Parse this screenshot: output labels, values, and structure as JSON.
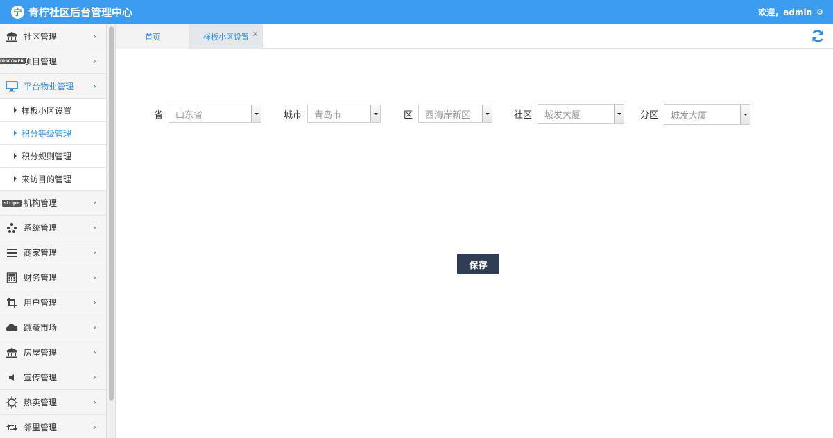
{
  "header": {
    "title": "青柠社区后台管理中心",
    "logo_char": "宁",
    "welcome": "欢迎，admin",
    "settings_icon": "gear-icon"
  },
  "sidebar": {
    "items": [
      {
        "label": "社区管理",
        "icon": "bank-icon"
      },
      {
        "label": "项目管理",
        "icon": "discover-card-icon"
      },
      {
        "label": "平台物业管理",
        "icon": "monitor-icon",
        "active": true,
        "children": [
          {
            "label": "样板小区设置"
          },
          {
            "label": "积分等级管理",
            "active": true
          },
          {
            "label": "积分规则管理"
          },
          {
            "label": "来访目的管理"
          }
        ]
      },
      {
        "label": "机构管理",
        "icon": "stripe-icon"
      },
      {
        "label": "系统管理",
        "icon": "yelp-icon"
      },
      {
        "label": "商家管理",
        "icon": "bars-icon"
      },
      {
        "label": "财务管理",
        "icon": "calculator-icon"
      },
      {
        "label": "用户管理",
        "icon": "crop-icon"
      },
      {
        "label": "跳蚤市场",
        "icon": "cloud-icon"
      },
      {
        "label": "房屋管理",
        "icon": "bank-icon"
      },
      {
        "label": "宣传管理",
        "icon": "volume-icon"
      },
      {
        "label": "热卖管理",
        "icon": "sun-icon"
      },
      {
        "label": "邻里管理",
        "icon": "retweet-icon"
      }
    ],
    "badges": {
      "discover": "DISCOVER",
      "stripe": "stripe"
    }
  },
  "tabs": [
    {
      "label": "首页"
    },
    {
      "label": "样板小区设置",
      "active": true,
      "close": "×"
    }
  ],
  "form": {
    "province": {
      "label": "省",
      "value": "山东省"
    },
    "city": {
      "label": "城市",
      "value": "青岛市"
    },
    "district": {
      "label": "区",
      "value": "西海岸新区"
    },
    "community": {
      "label": "社区",
      "value": "城发大厦"
    },
    "subdistrict": {
      "label": "分区",
      "value": "城发大厦"
    },
    "save_label": "保存"
  },
  "colors": {
    "topbar": "#3c9cf0",
    "accent": "#2b8be6",
    "button": "#2f3e52"
  }
}
